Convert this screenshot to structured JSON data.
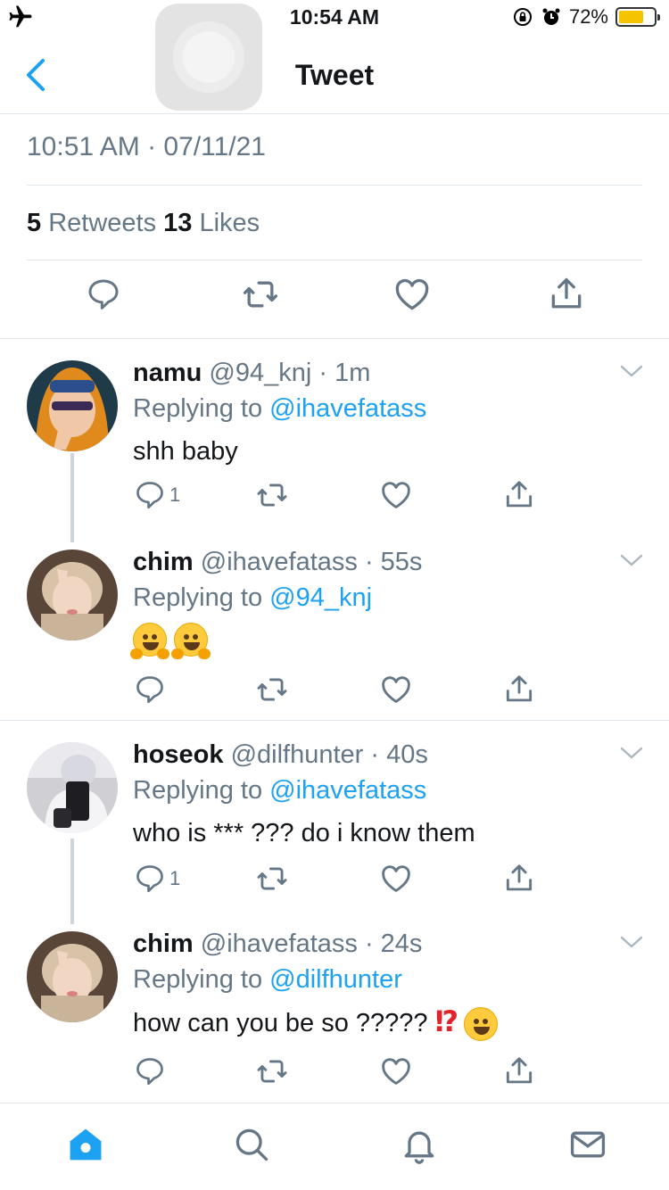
{
  "status_bar": {
    "time": "10:54 AM",
    "battery_percent": "72%",
    "battery_level": 0.72,
    "icons": [
      "airplane-icon",
      "orientation-lock-icon",
      "alarm-icon",
      "battery-icon"
    ]
  },
  "header": {
    "title": "Tweet",
    "back_icon": "chevron-left-icon"
  },
  "tweet": {
    "timestamp": "10:51 AM · 07/11/21",
    "retweet_count": "5",
    "retweet_label": "Retweets",
    "like_count": "13",
    "like_label": "Likes"
  },
  "replies": [
    {
      "name": "namu",
      "handle": "@94_knj",
      "time": "· 1m",
      "replying_prefix": "Replying to",
      "replying_to": "@ihavefatass",
      "text": "shh baby",
      "reply_count": "1"
    },
    {
      "name": "chim",
      "handle": "@ihavefatass",
      "time": "· 55s",
      "replying_prefix": "Replying to",
      "replying_to": "@94_knj",
      "text": "🤗🤗",
      "reply_count": ""
    },
    {
      "name": "hoseok",
      "handle": "@dilfhunter",
      "time": "· 40s",
      "replying_prefix": "Replying to",
      "replying_to": "@ihavefatass",
      "text": "who is *** ??? do i know them",
      "reply_count": "1"
    },
    {
      "name": "chim",
      "handle": "@ihavefatass",
      "time": "· 24s",
      "replying_prefix": "Replying to",
      "replying_to": "@dilfhunter",
      "text": "how can you be so ?????",
      "text_suffix_bang": "⁉",
      "reply_count": ""
    }
  ],
  "tab_bar": {
    "tabs": [
      "home-icon",
      "search-icon",
      "notifications-icon",
      "messages-icon"
    ],
    "active": "home-icon"
  },
  "colors": {
    "accent": "#1da1f2",
    "secondary_text": "#657786",
    "divider": "#e1e8ed"
  }
}
